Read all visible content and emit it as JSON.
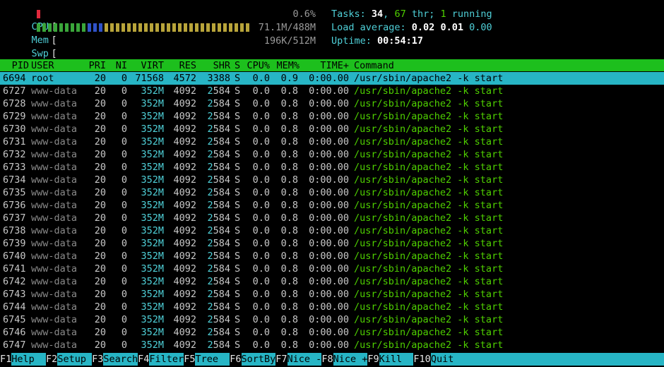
{
  "meters": {
    "cpu": {
      "label": "CPU",
      "value": "0.6%",
      "fraction": 0.006,
      "color": "#e0283c"
    },
    "mem": {
      "label": "Mem",
      "value": "71.1M/488M",
      "fraction": 0.146
    },
    "swp": {
      "label": "Swp",
      "value": "196K/512M",
      "fraction": 0.0
    }
  },
  "summary": {
    "tasks_label": "Tasks: ",
    "tasks": "34",
    "thr_sep": ", ",
    "threads": "67",
    "thr_label": " thr; ",
    "running": "1",
    "running_label": " running",
    "load_label": "Load average: ",
    "load1": "0.02",
    "load5": "0.01",
    "load15": "0.00",
    "uptime_label": "Uptime: ",
    "uptime": "00:54:17"
  },
  "header": {
    "pid": "PID",
    "user": "USER",
    "pri": "PRI",
    "ni": "NI",
    "virt": "VIRT",
    "res": "RES",
    "shr": "SHR",
    "s": "S",
    "cpu": "CPU%",
    "mem": "MEM%",
    "time": "TIME+",
    "command": "Command"
  },
  "processes": [
    {
      "pid": "6694",
      "user": "root",
      "pri": "20",
      "ni": "0",
      "virt": "71568",
      "res": "4572",
      "shr": "3388",
      "s": "S",
      "cpu": "0.0",
      "mem": "0.9",
      "time": "0:00.00",
      "cmd": "/usr/sbin/apache2 -k start"
    },
    {
      "pid": "6727",
      "user": "www-data",
      "pri": "20",
      "ni": "0",
      "virt": "352M",
      "res": "4092",
      "shr": "2584",
      "s": "S",
      "cpu": "0.0",
      "mem": "0.8",
      "time": "0:00.00",
      "cmd": "/usr/sbin/apache2 -k start"
    },
    {
      "pid": "6728",
      "user": "www-data",
      "pri": "20",
      "ni": "0",
      "virt": "352M",
      "res": "4092",
      "shr": "2584",
      "s": "S",
      "cpu": "0.0",
      "mem": "0.8",
      "time": "0:00.00",
      "cmd": "/usr/sbin/apache2 -k start"
    },
    {
      "pid": "6729",
      "user": "www-data",
      "pri": "20",
      "ni": "0",
      "virt": "352M",
      "res": "4092",
      "shr": "2584",
      "s": "S",
      "cpu": "0.0",
      "mem": "0.8",
      "time": "0:00.00",
      "cmd": "/usr/sbin/apache2 -k start"
    },
    {
      "pid": "6730",
      "user": "www-data",
      "pri": "20",
      "ni": "0",
      "virt": "352M",
      "res": "4092",
      "shr": "2584",
      "s": "S",
      "cpu": "0.0",
      "mem": "0.8",
      "time": "0:00.00",
      "cmd": "/usr/sbin/apache2 -k start"
    },
    {
      "pid": "6731",
      "user": "www-data",
      "pri": "20",
      "ni": "0",
      "virt": "352M",
      "res": "4092",
      "shr": "2584",
      "s": "S",
      "cpu": "0.0",
      "mem": "0.8",
      "time": "0:00.00",
      "cmd": "/usr/sbin/apache2 -k start"
    },
    {
      "pid": "6732",
      "user": "www-data",
      "pri": "20",
      "ni": "0",
      "virt": "352M",
      "res": "4092",
      "shr": "2584",
      "s": "S",
      "cpu": "0.0",
      "mem": "0.8",
      "time": "0:00.00",
      "cmd": "/usr/sbin/apache2 -k start"
    },
    {
      "pid": "6733",
      "user": "www-data",
      "pri": "20",
      "ni": "0",
      "virt": "352M",
      "res": "4092",
      "shr": "2584",
      "s": "S",
      "cpu": "0.0",
      "mem": "0.8",
      "time": "0:00.00",
      "cmd": "/usr/sbin/apache2 -k start"
    },
    {
      "pid": "6734",
      "user": "www-data",
      "pri": "20",
      "ni": "0",
      "virt": "352M",
      "res": "4092",
      "shr": "2584",
      "s": "S",
      "cpu": "0.0",
      "mem": "0.8",
      "time": "0:00.00",
      "cmd": "/usr/sbin/apache2 -k start"
    },
    {
      "pid": "6735",
      "user": "www-data",
      "pri": "20",
      "ni": "0",
      "virt": "352M",
      "res": "4092",
      "shr": "2584",
      "s": "S",
      "cpu": "0.0",
      "mem": "0.8",
      "time": "0:00.00",
      "cmd": "/usr/sbin/apache2 -k start"
    },
    {
      "pid": "6736",
      "user": "www-data",
      "pri": "20",
      "ni": "0",
      "virt": "352M",
      "res": "4092",
      "shr": "2584",
      "s": "S",
      "cpu": "0.0",
      "mem": "0.8",
      "time": "0:00.00",
      "cmd": "/usr/sbin/apache2 -k start"
    },
    {
      "pid": "6737",
      "user": "www-data",
      "pri": "20",
      "ni": "0",
      "virt": "352M",
      "res": "4092",
      "shr": "2584",
      "s": "S",
      "cpu": "0.0",
      "mem": "0.8",
      "time": "0:00.00",
      "cmd": "/usr/sbin/apache2 -k start"
    },
    {
      "pid": "6738",
      "user": "www-data",
      "pri": "20",
      "ni": "0",
      "virt": "352M",
      "res": "4092",
      "shr": "2584",
      "s": "S",
      "cpu": "0.0",
      "mem": "0.8",
      "time": "0:00.00",
      "cmd": "/usr/sbin/apache2 -k start"
    },
    {
      "pid": "6739",
      "user": "www-data",
      "pri": "20",
      "ni": "0",
      "virt": "352M",
      "res": "4092",
      "shr": "2584",
      "s": "S",
      "cpu": "0.0",
      "mem": "0.8",
      "time": "0:00.00",
      "cmd": "/usr/sbin/apache2 -k start"
    },
    {
      "pid": "6740",
      "user": "www-data",
      "pri": "20",
      "ni": "0",
      "virt": "352M",
      "res": "4092",
      "shr": "2584",
      "s": "S",
      "cpu": "0.0",
      "mem": "0.8",
      "time": "0:00.00",
      "cmd": "/usr/sbin/apache2 -k start"
    },
    {
      "pid": "6741",
      "user": "www-data",
      "pri": "20",
      "ni": "0",
      "virt": "352M",
      "res": "4092",
      "shr": "2584",
      "s": "S",
      "cpu": "0.0",
      "mem": "0.8",
      "time": "0:00.00",
      "cmd": "/usr/sbin/apache2 -k start"
    },
    {
      "pid": "6742",
      "user": "www-data",
      "pri": "20",
      "ni": "0",
      "virt": "352M",
      "res": "4092",
      "shr": "2584",
      "s": "S",
      "cpu": "0.0",
      "mem": "0.8",
      "time": "0:00.00",
      "cmd": "/usr/sbin/apache2 -k start"
    },
    {
      "pid": "6743",
      "user": "www-data",
      "pri": "20",
      "ni": "0",
      "virt": "352M",
      "res": "4092",
      "shr": "2584",
      "s": "S",
      "cpu": "0.0",
      "mem": "0.8",
      "time": "0:00.00",
      "cmd": "/usr/sbin/apache2 -k start"
    },
    {
      "pid": "6744",
      "user": "www-data",
      "pri": "20",
      "ni": "0",
      "virt": "352M",
      "res": "4092",
      "shr": "2584",
      "s": "S",
      "cpu": "0.0",
      "mem": "0.8",
      "time": "0:00.00",
      "cmd": "/usr/sbin/apache2 -k start"
    },
    {
      "pid": "6745",
      "user": "www-data",
      "pri": "20",
      "ni": "0",
      "virt": "352M",
      "res": "4092",
      "shr": "2584",
      "s": "S",
      "cpu": "0.0",
      "mem": "0.8",
      "time": "0:00.00",
      "cmd": "/usr/sbin/apache2 -k start"
    },
    {
      "pid": "6746",
      "user": "www-data",
      "pri": "20",
      "ni": "0",
      "virt": "352M",
      "res": "4092",
      "shr": "2584",
      "s": "S",
      "cpu": "0.0",
      "mem": "0.8",
      "time": "0:00.00",
      "cmd": "/usr/sbin/apache2 -k start"
    },
    {
      "pid": "6747",
      "user": "www-data",
      "pri": "20",
      "ni": "0",
      "virt": "352M",
      "res": "4092",
      "shr": "2584",
      "s": "S",
      "cpu": "0.0",
      "mem": "0.8",
      "time": "0:00.00",
      "cmd": "/usr/sbin/apache2 -k start"
    }
  ],
  "fkeys": [
    {
      "key": "F1",
      "label": "Help  "
    },
    {
      "key": "F2",
      "label": "Setup "
    },
    {
      "key": "F3",
      "label": "Search"
    },
    {
      "key": "F4",
      "label": "Filter"
    },
    {
      "key": "F5",
      "label": "Tree  "
    },
    {
      "key": "F6",
      "label": "SortBy"
    },
    {
      "key": "F7",
      "label": "Nice -"
    },
    {
      "key": "F8",
      "label": "Nice +"
    },
    {
      "key": "F9",
      "label": "Kill  "
    },
    {
      "key": "F10",
      "label": "Quit"
    }
  ],
  "colors": {
    "header_bg": "#1dbf1d",
    "selected_bg": "#27b5c5",
    "cyan": "#4fd0d8",
    "green": "#4fd000"
  }
}
